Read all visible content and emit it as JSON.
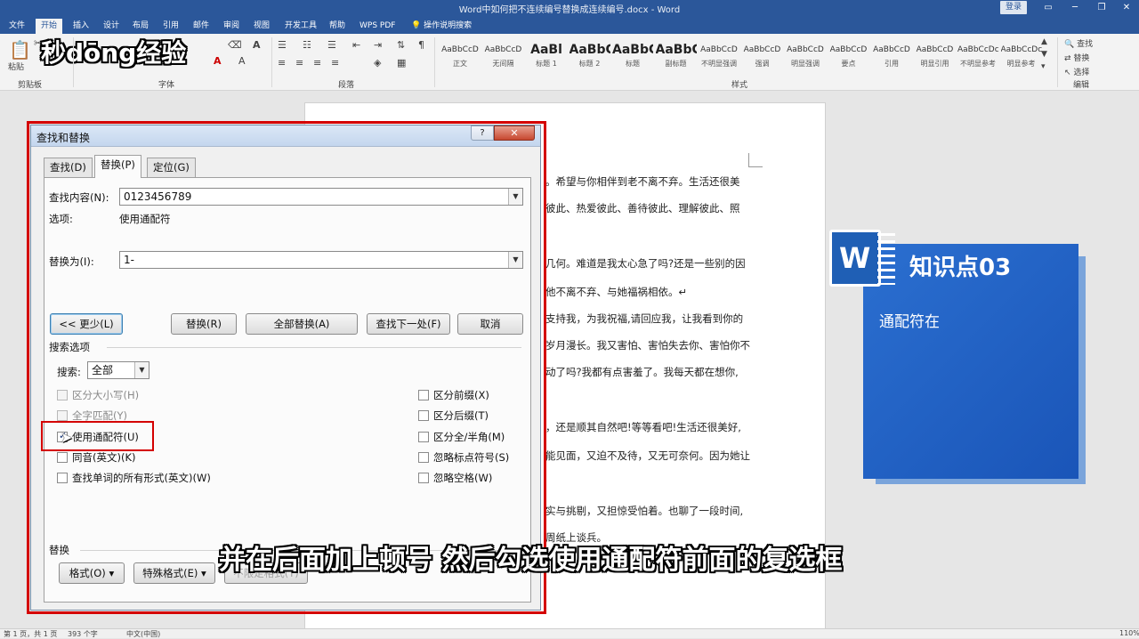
{
  "window": {
    "title": "Word中如何把不连续编号替换成连续编号.docx - Word",
    "login": "登录",
    "controls": [
      "▭",
      "─",
      "❐",
      "✕"
    ]
  },
  "tabs": [
    "文件",
    "开始",
    "插入",
    "设计",
    "布局",
    "引用",
    "邮件",
    "审阅",
    "视图",
    "开发工具",
    "帮助",
    "WPS PDF",
    "操作说明搜索"
  ],
  "ribbon": {
    "groups": {
      "clipboard": "剪贴板",
      "font": "字体",
      "paragraph": "段落",
      "styles": "样式",
      "editing": "编辑"
    },
    "paste_label": "粘贴",
    "styles": [
      {
        "preview": "AaBbCcD",
        "name": "正文"
      },
      {
        "preview": "AaBbCcD",
        "name": "无间隔"
      },
      {
        "preview": "AaBl",
        "name": "标题 1",
        "big": true
      },
      {
        "preview": "AaBbC",
        "name": "标题 2",
        "big": true
      },
      {
        "preview": "AaBbC",
        "name": "标题",
        "big": true
      },
      {
        "preview": "AaBbC",
        "name": "副标题",
        "big": true
      },
      {
        "preview": "AaBbCcD",
        "name": "不明显强调"
      },
      {
        "preview": "AaBbCcD",
        "name": "强调"
      },
      {
        "preview": "AaBbCcD",
        "name": "明显强调"
      },
      {
        "preview": "AaBbCcD",
        "name": "要点"
      },
      {
        "preview": "AaBbCcD",
        "name": "引用"
      },
      {
        "preview": "AaBbCcD",
        "name": "明显引用"
      },
      {
        "preview": "AaBbCcDc",
        "name": "不明显参考"
      },
      {
        "preview": "AaBbCcDc",
        "name": "明显参考"
      }
    ],
    "editing": [
      "查找",
      "替换",
      "选择"
    ],
    "logo": "秒dōng经验"
  },
  "document": {
    "lines": [
      "。希望与你相伴到老不离不弃。生活还很美",
      "彼此、热爱彼此、善待彼此、理解彼此、照",
      "几何。难道是我太心急了吗?还是一些别的因",
      "他不离不弃、与她福祸相依。↵",
      "支持我，为我祝福,请回应我，让我看到你的",
      "岁月漫长。我又害怕、害怕失去你、害怕你不",
      "动了吗?我都有点害羞了。我每天都在想你,",
      "，还是顺其自然吧!等等看吧!生活还很美好,",
      "能见面，又迫不及待，又无可奈何。因为她让",
      "实与挑剔，又担惊受怕着。也聊了一段时间,",
      "周纸上谈兵。"
    ]
  },
  "dialog": {
    "title": "查找和替换",
    "help": "?",
    "close": "✕",
    "tabs": [
      "查找(D)",
      "替换(P)",
      "定位(G)"
    ],
    "find_label": "查找内容(N):",
    "find_value": "0123456789",
    "options_label": "选项:",
    "options_value": "使用通配符",
    "replace_label": "替换为(I):",
    "replace_value": "1-",
    "buttons": {
      "less": "<< 更少(L)",
      "replace": "替换(R)",
      "replace_all": "全部替换(A)",
      "find_next": "查找下一处(F)",
      "cancel": "取消"
    },
    "search_options_heading": "搜索选项",
    "search_label": "搜索:",
    "search_value": "全部",
    "left_checks": [
      {
        "label": "区分大小写(H)",
        "checked": false,
        "disabled": true
      },
      {
        "label": "全字匹配(Y)",
        "checked": false,
        "disabled": true
      },
      {
        "label": "使用通配符(U)",
        "checked": true,
        "disabled": false
      },
      {
        "label": "同音(英文)(K)",
        "checked": false,
        "disabled": false
      },
      {
        "label": "查找单词的所有形式(英文)(W)",
        "checked": false,
        "disabled": false
      }
    ],
    "right_checks": [
      {
        "label": "区分前缀(X)",
        "checked": false,
        "disabled": false
      },
      {
        "label": "区分后缀(T)",
        "checked": false,
        "disabled": false
      },
      {
        "label": "区分全/半角(M)",
        "checked": false,
        "disabled": false
      },
      {
        "label": "忽略标点符号(S)",
        "checked": false,
        "disabled": false
      },
      {
        "label": "忽略空格(W)",
        "checked": false,
        "disabled": false
      }
    ],
    "replace_heading": "替换",
    "format_button": "格式(O) ▾",
    "special_button": "特殊格式(E) ▾",
    "no_format_button": "不限定格式(T)"
  },
  "overlay": {
    "word_letter": "W",
    "card_title": "知识点03",
    "card_sub": "通配符在"
  },
  "subtitle": "并在后面加上顿号  然后勾选使用通配符前面的复选框",
  "statusbar": {
    "page": "第 1 页，共 1 页",
    "words": "393 个字",
    "lang": "中文(中国)",
    "zoom": "110%"
  }
}
